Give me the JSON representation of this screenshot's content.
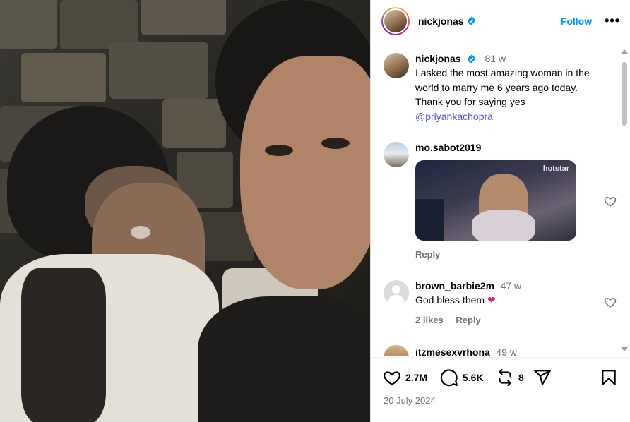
{
  "post": {
    "username": "nickjonas",
    "follow_label": "Follow",
    "more_label": "•••"
  },
  "caption": {
    "username": "nickjonas",
    "time": "81 w",
    "text": "I asked the most amazing woman in the world to marry me 6 years ago today. Thank you for saying yes",
    "mention": "@priyankachopra"
  },
  "comments": [
    {
      "username": "mo.sabot2019",
      "gif_brand": "hotstar",
      "reply_label": "Reply"
    },
    {
      "username": "brown_barbie2m",
      "time": "47 w",
      "text": "God bless them",
      "emoji": "❤",
      "likes": "2 likes",
      "reply_label": "Reply"
    },
    {
      "username": "itzmesexyrhona",
      "time": "49 w"
    }
  ],
  "actions": {
    "likes": "2.7M",
    "comments": "5.6K",
    "reposts": "8",
    "date": "20 July 2024"
  },
  "colors": {
    "accent": "#0095f6",
    "mention": "#5155d4",
    "muted": "#737373",
    "heart_emoji": "#e0245e"
  }
}
